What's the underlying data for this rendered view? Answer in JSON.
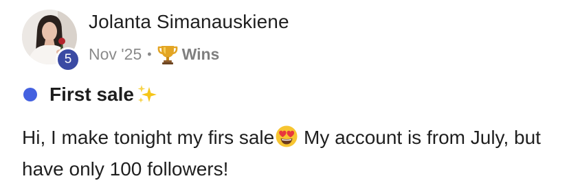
{
  "post": {
    "author": {
      "name": "Jolanta Simanauskiene",
      "level": "5",
      "avatar": "avatar-photo"
    },
    "meta": {
      "date": "Nov '25",
      "separator": "•",
      "category_icon": "trophy-icon",
      "category": "Wins"
    },
    "title": {
      "text": "First sale",
      "trailing_icon": "sparkles-icon",
      "unread_dot_color": "#4461e0"
    },
    "body": {
      "text_before_emoji": "Hi, I make tonight my firs sale",
      "emoji": "heart-eyes-icon",
      "text_after_emoji": " My account is from July, but have only 100 followers!"
    },
    "colors": {
      "level_badge": "#3b4aa3",
      "meta_text": "#8a8a8a"
    }
  }
}
